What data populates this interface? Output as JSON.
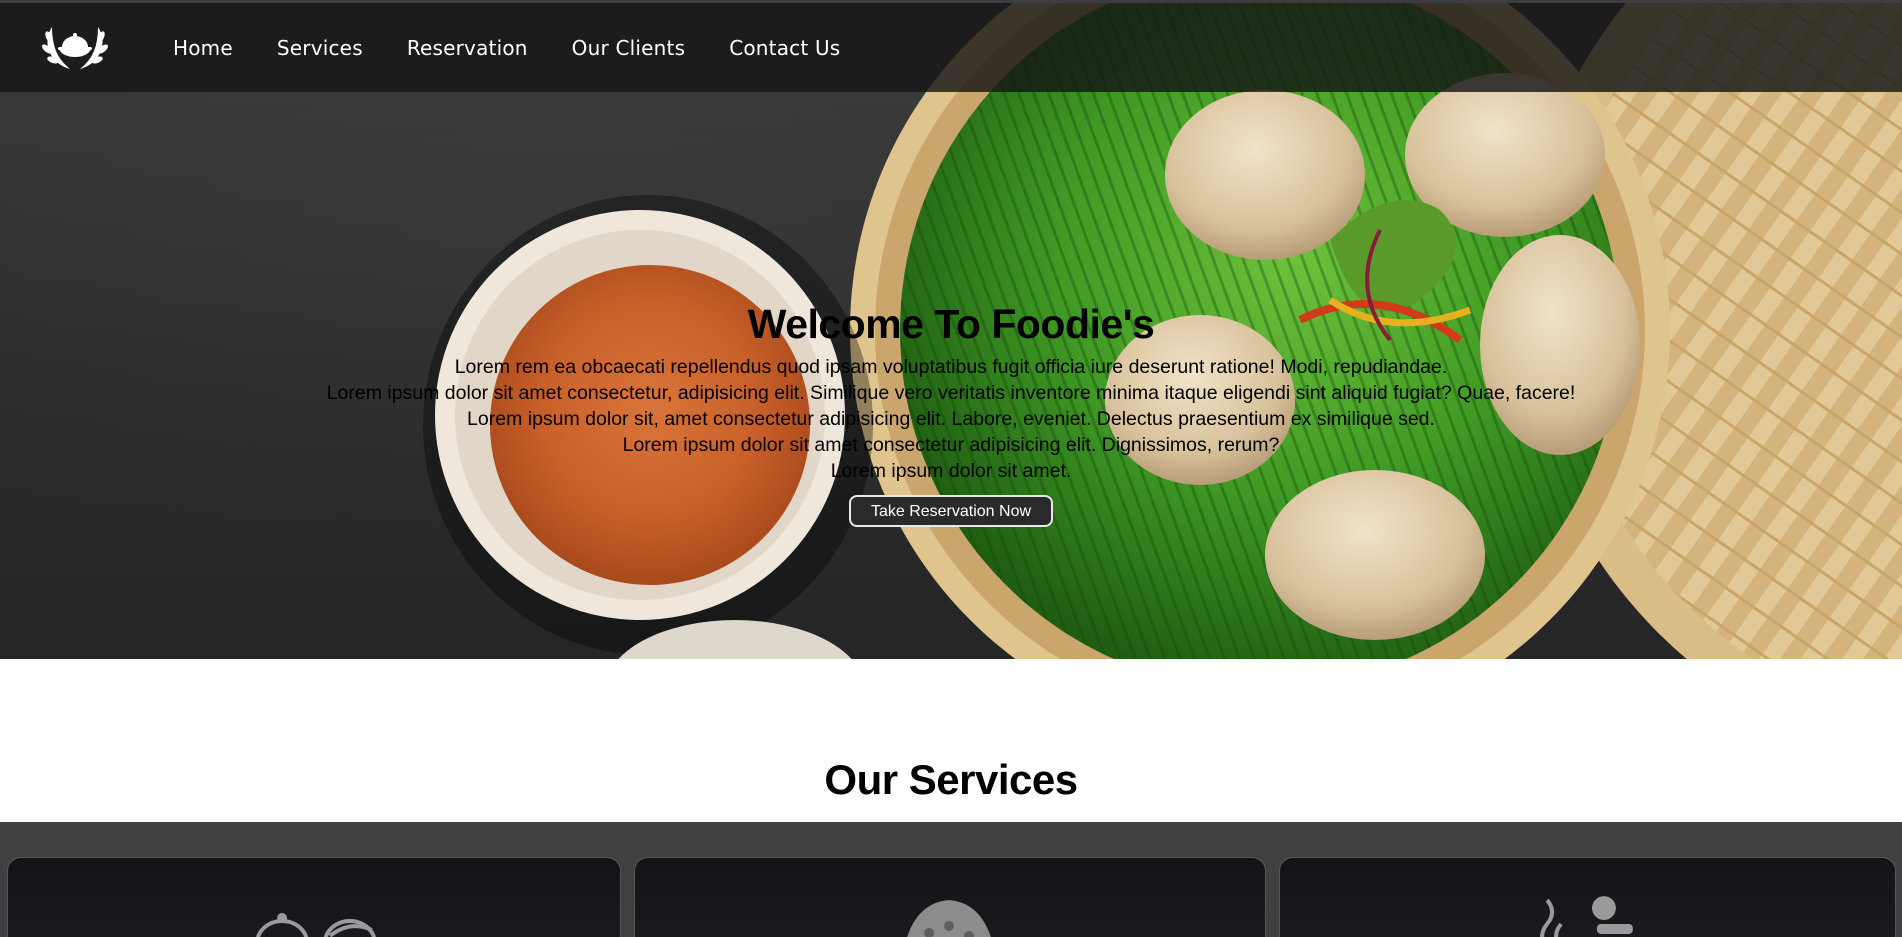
{
  "brand": {
    "logo_icon": "laurel-cloche-logo-icon"
  },
  "nav": {
    "items": [
      {
        "label": "Home"
      },
      {
        "label": "Services"
      },
      {
        "label": "Reservation"
      },
      {
        "label": "Our Clients"
      },
      {
        "label": "Contact Us"
      }
    ]
  },
  "hero": {
    "title": "Welcome To Foodie's",
    "lines": [
      "Lorem rem ea obcaecati repellendus quod ipsam voluptatibus fugit officia iure deserunt ratione! Modi, repudiandae.",
      "Lorem ipsum dolor sit amet consectetur, adipisicing elit. Similique vero veritatis inventore minima itaque eligendi sint aliquid fugiat? Quae, facere!",
      "Lorem ipsum dolor sit, amet consectetur adipisicing elit. Labore, eveniet. Delectus praesentium ex similique sed.",
      "Lorem ipsum dolor sit amet consectetur adipisicing elit. Dignissimos, rerum?",
      "Lorem ipsum dolor sit amet."
    ],
    "cta_label": "Take Reservation Now",
    "background_image": "dumplings-in-bamboo-steamer-with-chutney-bowl"
  },
  "services": {
    "title": "Our Services",
    "cards": [
      {
        "icon": "serving-cloche-icon"
      },
      {
        "icon": "dumpling-icon"
      },
      {
        "icon": "chef-steam-icon"
      }
    ]
  },
  "colors": {
    "nav_bg": "#161616",
    "services_band": "#3f4140",
    "card_bg": "#121418",
    "text": "#000000",
    "nav_text": "#ffffff"
  }
}
